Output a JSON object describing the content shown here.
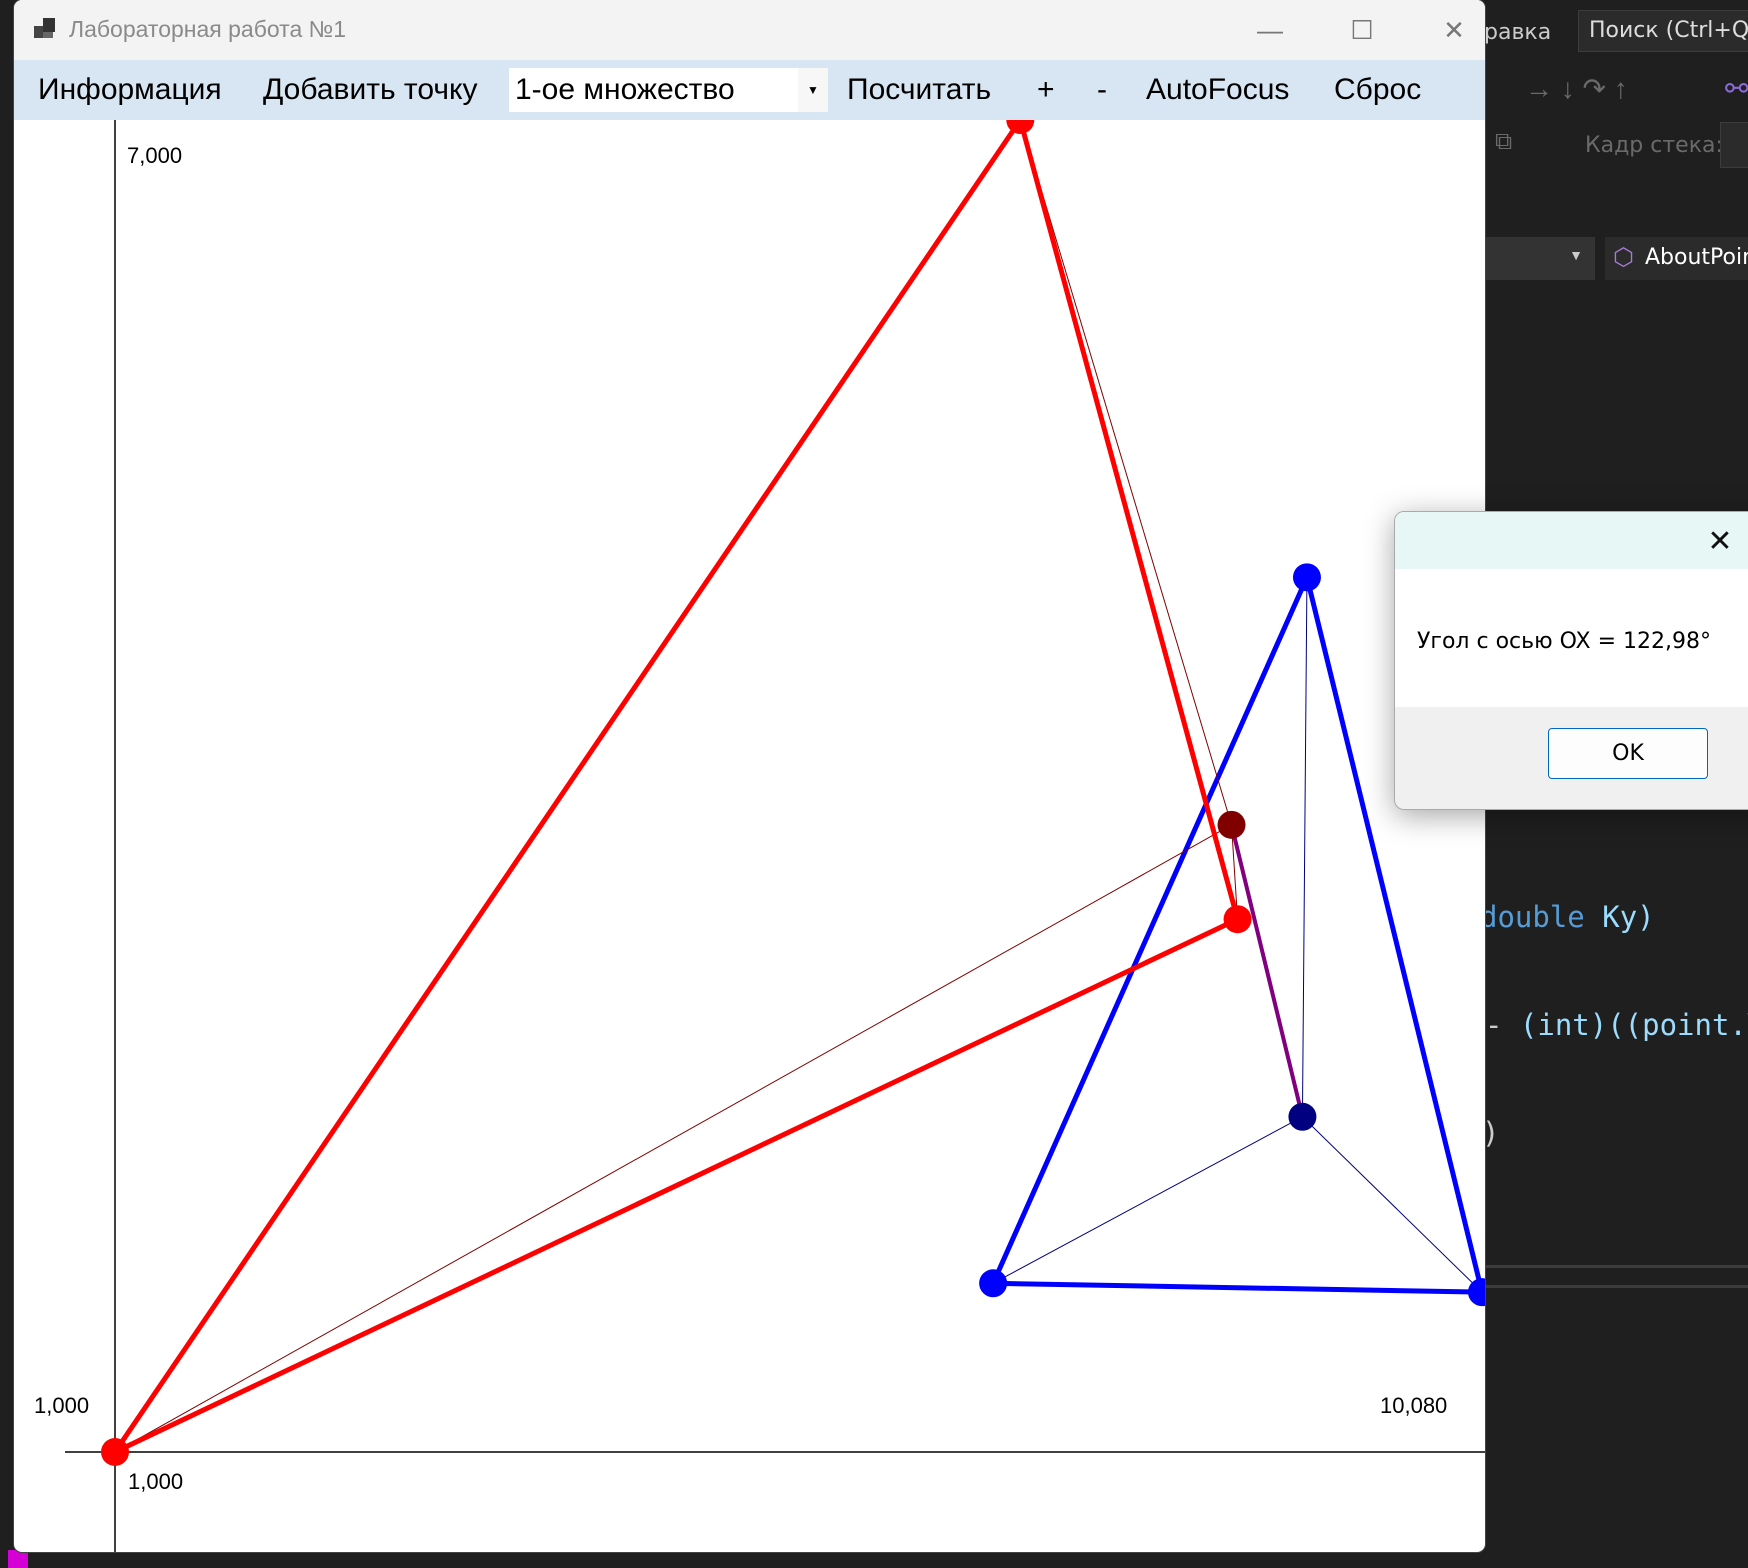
{
  "background_ide": {
    "menu_fragment": "равка",
    "search_placeholder": "Поиск (Ctrl+Q)",
    "stack_frame_label": "Кадр стека:",
    "class_dropdown": "AboutPoin",
    "code_lines": [
      "double",
      "Ky)",
      "- ",
      "(int)((point.Y",
      ")"
    ]
  },
  "window": {
    "title": "Лабораторная работа №1",
    "minimize": "—",
    "maximize": "☐",
    "close": "✕"
  },
  "menu": {
    "info": "Информация",
    "add_point": "Добавить точку",
    "set_select": "1-ое множество",
    "calculate": "Посчитать",
    "zoom_in": "+",
    "zoom_out": "-",
    "autofocus": "AutoFocus",
    "reset": "Сброс"
  },
  "axes": {
    "y_top": "7,000",
    "y_origin": "1,000",
    "x_origin": "1,000",
    "x_right": "10,080"
  },
  "colors": {
    "set1": "#ff0000",
    "set1_center": "#800000",
    "set2": "#0000ff",
    "set2_center": "#000080",
    "connector": "#800080"
  },
  "plot": {
    "x_range": [
      1000,
      10080
    ],
    "y_range": [
      1000,
      7000
    ],
    "set1": [
      [
        1000,
        1000
      ],
      [
        7000,
        7000
      ],
      [
        8440,
        3400
      ]
    ],
    "set1_center": [
      8400,
      3825
    ],
    "set2": [
      [
        8900,
        4940
      ],
      [
        6820,
        1760
      ],
      [
        10060,
        1720
      ]
    ],
    "set2_center": [
      8870,
      2510
    ]
  },
  "dialog": {
    "close": "✕",
    "message": "Угол с осью OX = 122,98°",
    "ok": "OK"
  }
}
